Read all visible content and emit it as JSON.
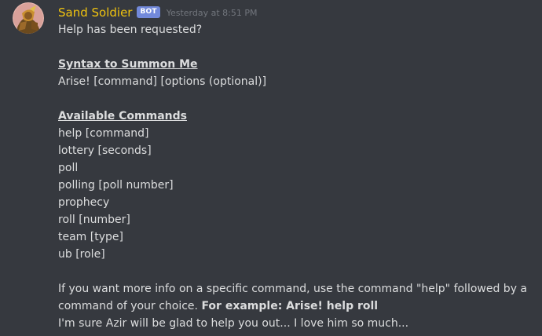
{
  "message": {
    "author": "Sand Soldier",
    "bot_tag": "BOT",
    "timestamp": "Yesterday at 8:51 PM",
    "colors": {
      "background": "#36393f",
      "username": "#f1c40f",
      "bot_tag": "#7289da",
      "text": "#dcddde",
      "timestamp": "#72767d"
    },
    "intro": "Help has been requested?",
    "syntax": {
      "title": "Syntax to Summon Me",
      "text": "Arise! [command] [options (optional)]"
    },
    "commands": {
      "title": "Available Commands",
      "items": [
        "help [command]",
        "lottery [seconds]",
        "poll",
        "polling [poll number]",
        "prophecy",
        "roll [number]",
        "team [type]",
        "ub [role]"
      ]
    },
    "outro": {
      "line1": "If you want more info on a specific command, use the command \"help\" followed by a",
      "line2_prefix": "command of your choice. ",
      "line2_bold": "For example: Arise! help roll",
      "line3": "I'm sure Azir will be glad to help you out... I love him so much..."
    }
  }
}
